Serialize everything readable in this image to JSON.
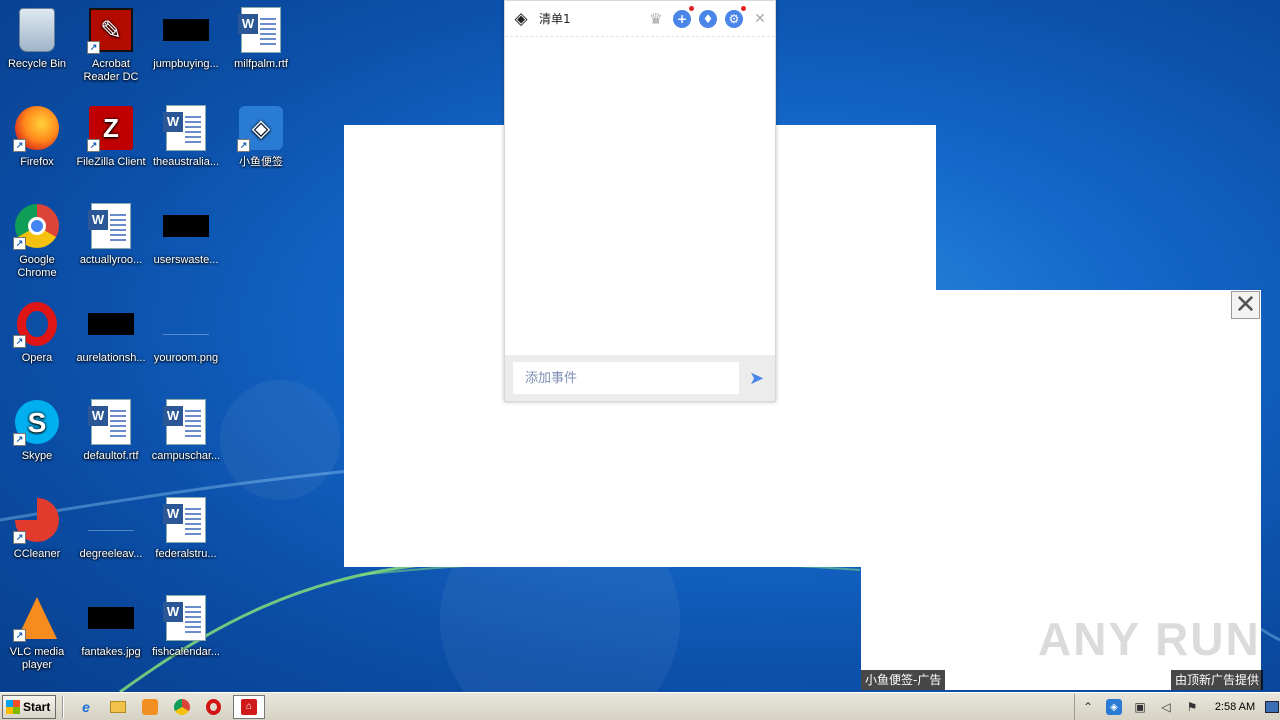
{
  "desktop": {
    "icons": [
      {
        "label": "Recycle Bin"
      },
      {
        "label": "Acrobat Reader DC"
      },
      {
        "label": "jumpbuying..."
      },
      {
        "label": "milfpalm.rtf"
      },
      {
        "label": "Firefox"
      },
      {
        "label": "FileZilla Client"
      },
      {
        "label": "theaustralia..."
      },
      {
        "label": "小鱼便签"
      },
      {
        "label": "Google Chrome"
      },
      {
        "label": "actuallyroo..."
      },
      {
        "label": "userswaste..."
      },
      {
        "label": "Opera"
      },
      {
        "label": "aurelationsh..."
      },
      {
        "label": "youroom.png"
      },
      {
        "label": "Skype"
      },
      {
        "label": "defaultof.rtf"
      },
      {
        "label": "campuschar..."
      },
      {
        "label": "CCleaner"
      },
      {
        "label": "degreeleav..."
      },
      {
        "label": "federalstru..."
      },
      {
        "label": "VLC media player"
      },
      {
        "label": "fantakes.jpg"
      },
      {
        "label": "fishcalendar..."
      }
    ]
  },
  "note_widget": {
    "title": "清单1",
    "input_placeholder": "添加事件",
    "icons": [
      "logo-icon",
      "crown-icon",
      "add-icon",
      "skin-icon",
      "settings-icon",
      "close-icon"
    ],
    "accent_color": "#4a86e8"
  },
  "ad": {
    "left_tag": "小鱼便签-广告",
    "right_tag": "由顶新广告提供",
    "close_symbol": "✕"
  },
  "watermark": {
    "text": "ANY RUN"
  },
  "taskbar": {
    "start_label": "Start",
    "clock": "2:58 AM",
    "pinned": [
      "ie-icon",
      "explorer-icon",
      "media-player-icon",
      "chrome-icon",
      "opera-icon"
    ],
    "active_app": "pdf-icon"
  }
}
